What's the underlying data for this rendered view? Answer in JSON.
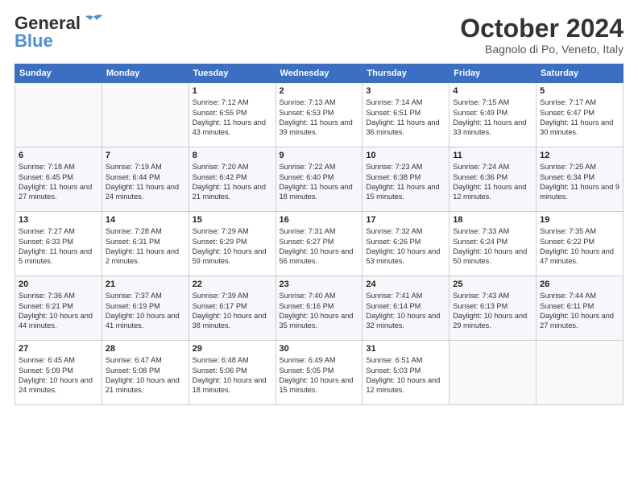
{
  "logo": {
    "line1": "General",
    "line2": "Blue"
  },
  "header": {
    "month": "October 2024",
    "location": "Bagnolo di Po, Veneto, Italy"
  },
  "weekdays": [
    "Sunday",
    "Monday",
    "Tuesday",
    "Wednesday",
    "Thursday",
    "Friday",
    "Saturday"
  ],
  "weeks": [
    [
      {
        "day": "",
        "info": ""
      },
      {
        "day": "",
        "info": ""
      },
      {
        "day": "1",
        "info": "Sunrise: 7:12 AM\nSunset: 6:55 PM\nDaylight: 11 hours and 43 minutes."
      },
      {
        "day": "2",
        "info": "Sunrise: 7:13 AM\nSunset: 6:53 PM\nDaylight: 11 hours and 39 minutes."
      },
      {
        "day": "3",
        "info": "Sunrise: 7:14 AM\nSunset: 6:51 PM\nDaylight: 11 hours and 36 minutes."
      },
      {
        "day": "4",
        "info": "Sunrise: 7:15 AM\nSunset: 6:49 PM\nDaylight: 11 hours and 33 minutes."
      },
      {
        "day": "5",
        "info": "Sunrise: 7:17 AM\nSunset: 6:47 PM\nDaylight: 11 hours and 30 minutes."
      }
    ],
    [
      {
        "day": "6",
        "info": "Sunrise: 7:18 AM\nSunset: 6:45 PM\nDaylight: 11 hours and 27 minutes."
      },
      {
        "day": "7",
        "info": "Sunrise: 7:19 AM\nSunset: 6:44 PM\nDaylight: 11 hours and 24 minutes."
      },
      {
        "day": "8",
        "info": "Sunrise: 7:20 AM\nSunset: 6:42 PM\nDaylight: 11 hours and 21 minutes."
      },
      {
        "day": "9",
        "info": "Sunrise: 7:22 AM\nSunset: 6:40 PM\nDaylight: 11 hours and 18 minutes."
      },
      {
        "day": "10",
        "info": "Sunrise: 7:23 AM\nSunset: 6:38 PM\nDaylight: 11 hours and 15 minutes."
      },
      {
        "day": "11",
        "info": "Sunrise: 7:24 AM\nSunset: 6:36 PM\nDaylight: 11 hours and 12 minutes."
      },
      {
        "day": "12",
        "info": "Sunrise: 7:25 AM\nSunset: 6:34 PM\nDaylight: 11 hours and 9 minutes."
      }
    ],
    [
      {
        "day": "13",
        "info": "Sunrise: 7:27 AM\nSunset: 6:33 PM\nDaylight: 11 hours and 5 minutes."
      },
      {
        "day": "14",
        "info": "Sunrise: 7:28 AM\nSunset: 6:31 PM\nDaylight: 11 hours and 2 minutes."
      },
      {
        "day": "15",
        "info": "Sunrise: 7:29 AM\nSunset: 6:29 PM\nDaylight: 10 hours and 59 minutes."
      },
      {
        "day": "16",
        "info": "Sunrise: 7:31 AM\nSunset: 6:27 PM\nDaylight: 10 hours and 56 minutes."
      },
      {
        "day": "17",
        "info": "Sunrise: 7:32 AM\nSunset: 6:26 PM\nDaylight: 10 hours and 53 minutes."
      },
      {
        "day": "18",
        "info": "Sunrise: 7:33 AM\nSunset: 6:24 PM\nDaylight: 10 hours and 50 minutes."
      },
      {
        "day": "19",
        "info": "Sunrise: 7:35 AM\nSunset: 6:22 PM\nDaylight: 10 hours and 47 minutes."
      }
    ],
    [
      {
        "day": "20",
        "info": "Sunrise: 7:36 AM\nSunset: 6:21 PM\nDaylight: 10 hours and 44 minutes."
      },
      {
        "day": "21",
        "info": "Sunrise: 7:37 AM\nSunset: 6:19 PM\nDaylight: 10 hours and 41 minutes."
      },
      {
        "day": "22",
        "info": "Sunrise: 7:39 AM\nSunset: 6:17 PM\nDaylight: 10 hours and 38 minutes."
      },
      {
        "day": "23",
        "info": "Sunrise: 7:40 AM\nSunset: 6:16 PM\nDaylight: 10 hours and 35 minutes."
      },
      {
        "day": "24",
        "info": "Sunrise: 7:41 AM\nSunset: 6:14 PM\nDaylight: 10 hours and 32 minutes."
      },
      {
        "day": "25",
        "info": "Sunrise: 7:43 AM\nSunset: 6:13 PM\nDaylight: 10 hours and 29 minutes."
      },
      {
        "day": "26",
        "info": "Sunrise: 7:44 AM\nSunset: 6:11 PM\nDaylight: 10 hours and 27 minutes."
      }
    ],
    [
      {
        "day": "27",
        "info": "Sunrise: 6:45 AM\nSunset: 5:09 PM\nDaylight: 10 hours and 24 minutes."
      },
      {
        "day": "28",
        "info": "Sunrise: 6:47 AM\nSunset: 5:08 PM\nDaylight: 10 hours and 21 minutes."
      },
      {
        "day": "29",
        "info": "Sunrise: 6:48 AM\nSunset: 5:06 PM\nDaylight: 10 hours and 18 minutes."
      },
      {
        "day": "30",
        "info": "Sunrise: 6:49 AM\nSunset: 5:05 PM\nDaylight: 10 hours and 15 minutes."
      },
      {
        "day": "31",
        "info": "Sunrise: 6:51 AM\nSunset: 5:03 PM\nDaylight: 10 hours and 12 minutes."
      },
      {
        "day": "",
        "info": ""
      },
      {
        "day": "",
        "info": ""
      }
    ]
  ]
}
